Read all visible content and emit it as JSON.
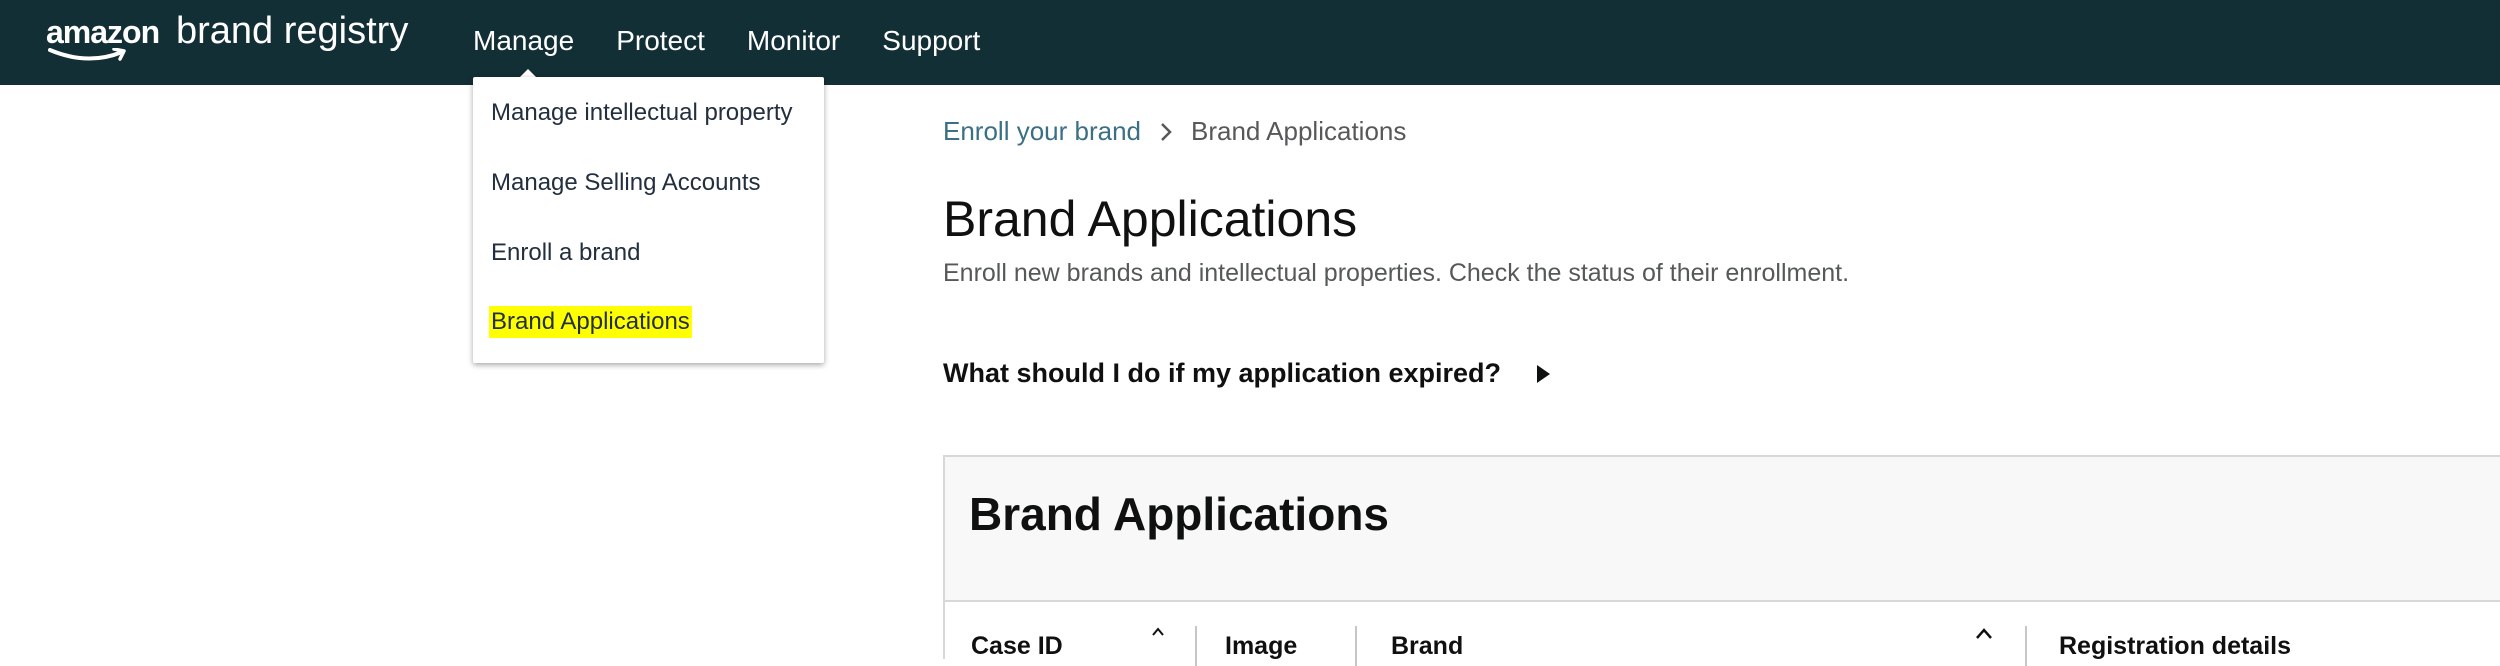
{
  "brand": {
    "logo_amazon": "amazon",
    "logo_registry": "brand registry"
  },
  "nav": {
    "items": [
      "Manage",
      "Protect",
      "Monitor",
      "Support"
    ],
    "active": "Manage"
  },
  "dropdown": {
    "items": [
      "Manage intellectual property",
      "Manage Selling Accounts",
      "Enroll a brand",
      "Brand Applications"
    ],
    "highlighted": "Brand Applications"
  },
  "breadcrumb": {
    "parent": "Enroll your brand",
    "current": "Brand Applications"
  },
  "page": {
    "title": "Brand Applications",
    "description": "Enroll new brands and intellectual properties. Check the status of their enrollment."
  },
  "faq": {
    "question": "What should I do if my application expired?"
  },
  "panel": {
    "title": "Brand Applications",
    "columns": [
      "Case ID",
      "Image",
      "Brand",
      "Registration details"
    ]
  },
  "colors": {
    "topbar": "#132f36",
    "highlight": "#ffff00",
    "link": "#3a6f85"
  }
}
